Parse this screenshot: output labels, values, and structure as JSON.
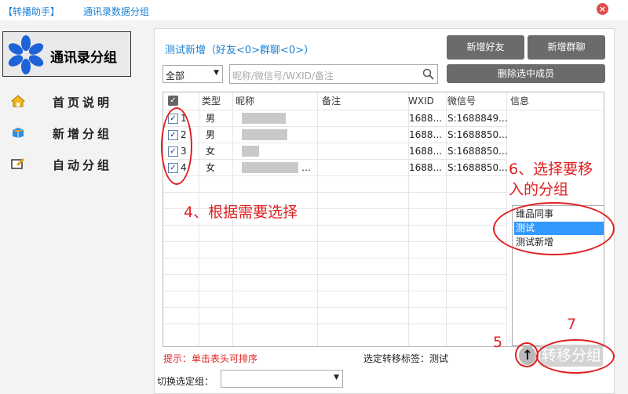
{
  "title_bar": {
    "app": "【转播助手】",
    "window": "通讯录数据分组",
    "close": "×"
  },
  "sidebar": {
    "logo_text": "通讯录分组",
    "items": [
      {
        "label": "首页说明",
        "icon": "home-icon"
      },
      {
        "label": "新增分组",
        "icon": "box-icon"
      },
      {
        "label": "自动分组",
        "icon": "edit-icon"
      }
    ]
  },
  "main": {
    "list_title": "测试新增（好友<0>群聊<0>）",
    "buttons": {
      "add_friend": "新增好友",
      "add_group_chat": "新增群聊",
      "delete_selected": "删除选中成员"
    },
    "filter": {
      "value": "全部"
    },
    "search": {
      "placeholder": "昵称/微信号/WXID/备注"
    },
    "table": {
      "columns": [
        "类型",
        "昵称",
        "备注",
        "WXID",
        "微信号",
        "信息"
      ],
      "rows": [
        {
          "num": "1",
          "type": "男",
          "nickname": "",
          "note": "",
          "wxid": "1688...",
          "wechat_id": "S:1688849..."
        },
        {
          "num": "2",
          "type": "男",
          "nickname": "",
          "note": "",
          "wxid": "1688...",
          "wechat_id": "S:1688850..."
        },
        {
          "num": "3",
          "type": "女",
          "nickname": "",
          "note": "",
          "wxid": "1688...",
          "wechat_id": "S:1688850..."
        },
        {
          "num": "4",
          "type": "女",
          "nickname": "…",
          "note": "",
          "wxid": "1688...",
          "wechat_id": "S:1688850..."
        }
      ]
    },
    "groups": [
      "维品同事",
      "测试",
      "测试新增"
    ],
    "selected_group": "测试",
    "hint": "提示：单击表头可排序",
    "selected_tag_text": "选定转移标签：测试",
    "move_button": "转移分组",
    "up_button": "↑",
    "switch_group_label": "切换选定组："
  },
  "annotations": {
    "a4": "4、根据需要选择",
    "a5": "5",
    "a6": "6、选择要移入的分组",
    "a7": "7"
  },
  "colors": {
    "accent": "#1a7fd1",
    "annotation": "#e02020",
    "selected": "#3399ff",
    "button": "#6b6b6b"
  }
}
